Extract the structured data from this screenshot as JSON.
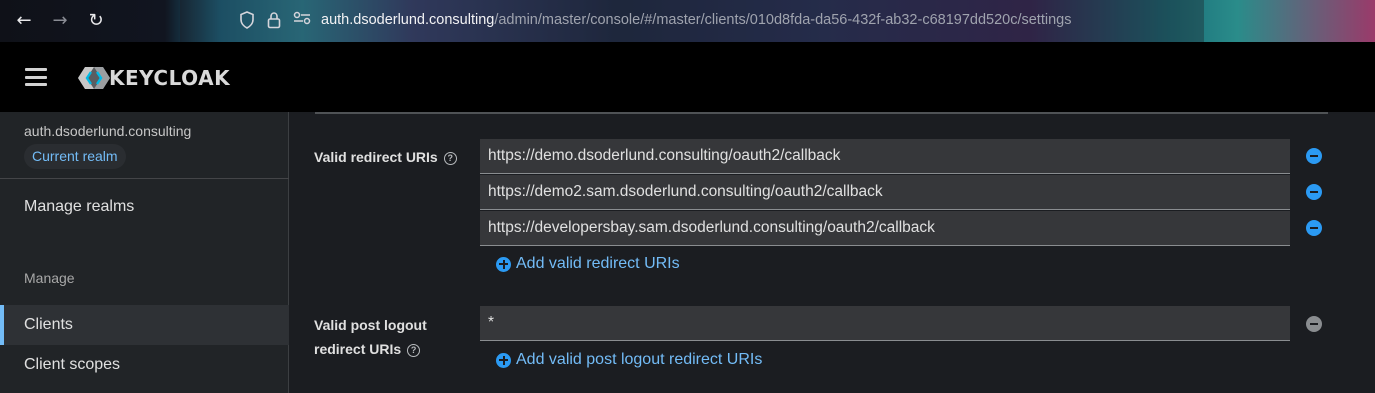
{
  "browser": {
    "back_icon": "arrow-left-icon",
    "forward_icon": "arrow-right-icon",
    "reload_icon": "reload-icon",
    "url_domain": "auth.dsoderlund.consulting",
    "url_path": "/admin/master/console/#/master/clients/010d8fda-da56-432f-ab32-c68197dd520c/settings"
  },
  "header": {
    "logo_text": "KEYCLOAK"
  },
  "sidebar": {
    "realm_name": "auth.dsoderlund.consulting",
    "realm_badge": "Current realm",
    "manage_realms": "Manage realms",
    "section_manage": "Manage",
    "items": [
      {
        "label": "Clients",
        "active": true
      },
      {
        "label": "Client scopes",
        "active": false
      }
    ]
  },
  "form": {
    "redirect_label": "Valid redirect URIs",
    "redirect_uris": [
      "https://demo.dsoderlund.consulting/oauth2/callback",
      "https://demo2.sam.dsoderlund.consulting/oauth2/callback",
      "https://developersbay.sam.dsoderlund.consulting/oauth2/callback"
    ],
    "add_redirect": "Add valid redirect URIs",
    "post_logout_label_line1": "Valid post logout",
    "post_logout_label_line2": "redirect URIs",
    "post_logout_uris": [
      "*"
    ],
    "add_post_logout": "Add valid post logout redirect URIs"
  },
  "colors": {
    "accent": "#73bcf7",
    "primary": "#2b9af3",
    "header_bg": "#000000",
    "sidebar_bg": "#212427"
  }
}
